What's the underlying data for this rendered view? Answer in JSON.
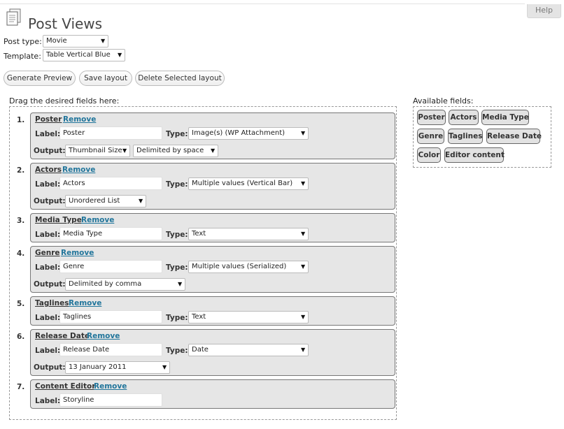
{
  "help": {
    "label": "Help"
  },
  "page": {
    "title": "Post Views",
    "icon": "page-icon"
  },
  "settings": {
    "post_type_label": "Post type:",
    "post_type_value": "Movie",
    "template_label": "Template:",
    "template_value": "Table Vertical Blue"
  },
  "buttons": {
    "generate": "Generate Preview",
    "save": "Save layout",
    "delete": "Delete Selected layout"
  },
  "drop_zone": {
    "title": "Drag the desired fields here:"
  },
  "available": {
    "title": "Available fields:",
    "chips": [
      "Poster",
      "Actors",
      "Media Type",
      "Genre",
      "Taglines",
      "Release Date",
      "Color",
      "Editor content"
    ]
  },
  "common": {
    "remove": "Remove",
    "label_label": "Label:",
    "type_label": "Type:",
    "output_label": "Output:"
  },
  "fields": [
    {
      "num": "1.",
      "name": "Poster",
      "label": "Poster",
      "type": "Image(s) (WP Attachment)",
      "outputs": [
        "Thumbnail Size",
        "Delimited by space"
      ]
    },
    {
      "num": "2.",
      "name": "Actors",
      "label": "Actors",
      "type": "Multiple values (Vertical Bar)",
      "outputs": [
        "Unordered List"
      ]
    },
    {
      "num": "3.",
      "name": "Media Type",
      "label": "Media Type",
      "type": "Text",
      "outputs": []
    },
    {
      "num": "4.",
      "name": "Genre",
      "label": "Genre",
      "type": "Multiple values (Serialized)",
      "outputs": [
        "Delimited by comma"
      ]
    },
    {
      "num": "5.",
      "name": "Taglines",
      "label": "Taglines",
      "type": "Text",
      "outputs": []
    },
    {
      "num": "6.",
      "name": "Release Date",
      "label": "Release Date",
      "type": "Date",
      "outputs": [
        "13 January 2011"
      ]
    },
    {
      "num": "7.",
      "name": "Content Editor",
      "label": "Storyline",
      "type": "",
      "outputs": []
    }
  ]
}
